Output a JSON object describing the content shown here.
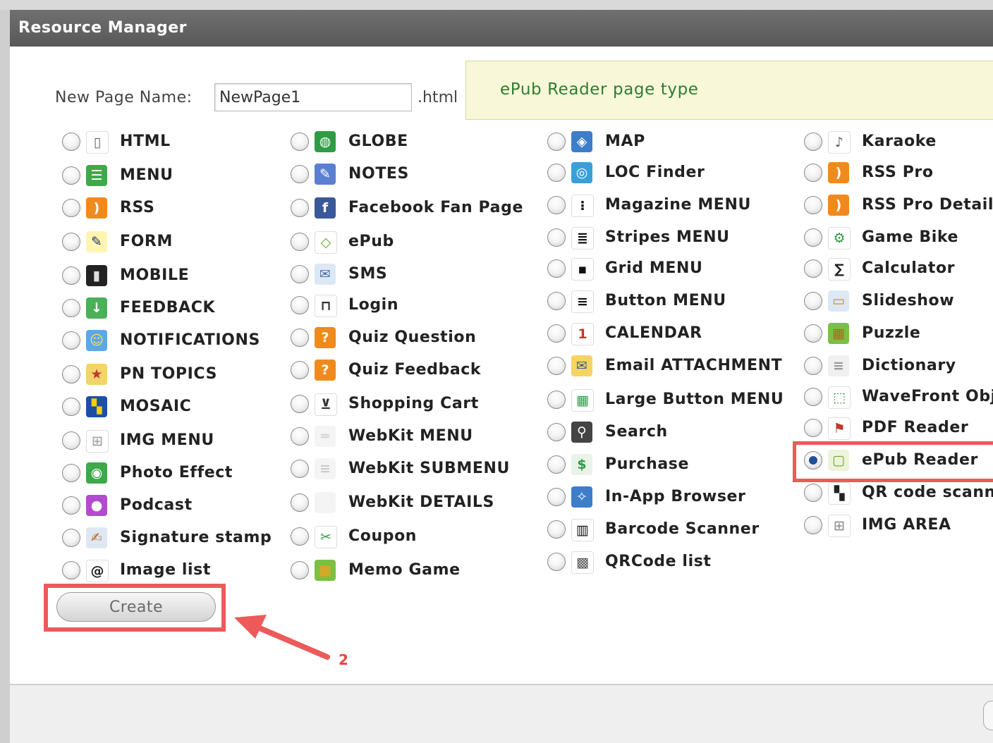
{
  "dialog": {
    "title": "Resource Manager",
    "page_name_label": "New Page Name:",
    "page_name_value": "NewPage1",
    "extension": ".html",
    "info_text": "ePub Reader page type",
    "create_label": "Create",
    "annotation_number": "2"
  },
  "columns": [
    [
      {
        "label": "HTML",
        "icon": "document-icon",
        "bg": "#ffffff",
        "fg": "#666666",
        "glyph": "▯"
      },
      {
        "label": "MENU",
        "icon": "menu-list-icon",
        "bg": "#3daa4a",
        "fg": "#ffffff",
        "glyph": "☰"
      },
      {
        "label": "RSS",
        "icon": "rss-icon",
        "bg": "#f08a1c",
        "fg": "#ffffff",
        "glyph": ")"
      },
      {
        "label": "FORM",
        "icon": "pencil-icon",
        "bg": "#fff5b0",
        "fg": "#223366",
        "glyph": "✎"
      },
      {
        "label": "MOBILE",
        "icon": "mobile-phone-icon",
        "bg": "#222222",
        "fg": "#dddddd",
        "glyph": "▮"
      },
      {
        "label": "FEEDBACK",
        "icon": "download-arrow-icon",
        "bg": "#49b157",
        "fg": "#ffffff",
        "glyph": "↓"
      },
      {
        "label": "NOTIFICATIONS",
        "icon": "smiley-icon",
        "bg": "#5aa8e8",
        "fg": "#ffe04a",
        "glyph": "☺"
      },
      {
        "label": "PN TOPICS",
        "icon": "star-tag-icon",
        "bg": "#f3d36b",
        "fg": "#c0392b",
        "glyph": "★"
      },
      {
        "label": "MOSAIC",
        "icon": "mosaic-icon",
        "bg": "#1b4fa8",
        "fg": "#ffcc00",
        "glyph": "▚"
      },
      {
        "label": "IMG MENU",
        "icon": "grid-icon",
        "bg": "#ffffff",
        "fg": "#aaaaaa",
        "glyph": "⊞"
      },
      {
        "label": "Photo Effect",
        "icon": "camera-icon",
        "bg": "#3daa4a",
        "fg": "#ffffff",
        "glyph": "◉"
      },
      {
        "label": "Podcast",
        "icon": "microphone-icon",
        "bg": "#b34bd1",
        "fg": "#ffffff",
        "glyph": "●"
      },
      {
        "label": "Signature stamp",
        "icon": "signature-icon",
        "bg": "#dfe7f3",
        "fg": "#b5651d",
        "glyph": "✍"
      },
      {
        "label": "Image list",
        "icon": "at-sign-icon",
        "bg": "#ffffff",
        "fg": "#222222",
        "glyph": "@"
      }
    ],
    [
      {
        "label": "GLOBE",
        "icon": "globe-icon",
        "bg": "#2e9c45",
        "fg": "#ffffff",
        "glyph": "◍"
      },
      {
        "label": "NOTES",
        "icon": "notes-icon",
        "bg": "#5b7fd1",
        "fg": "#ffffff",
        "glyph": "✎"
      },
      {
        "label": "Facebook Fan Page",
        "icon": "facebook-icon",
        "bg": "#3b5998",
        "fg": "#ffffff",
        "glyph": "f"
      },
      {
        "label": "ePub",
        "icon": "epub-icon",
        "bg": "#ffffff",
        "fg": "#6aa82d",
        "glyph": "◇"
      },
      {
        "label": "SMS",
        "icon": "envelope-icon",
        "bg": "#dde8f6",
        "fg": "#4a6fa5",
        "glyph": "✉"
      },
      {
        "label": "Login",
        "icon": "padlock-icon",
        "bg": "#ffffff",
        "fg": "#333333",
        "glyph": "⊓"
      },
      {
        "label": "Quiz Question",
        "icon": "question-mark-icon",
        "bg": "#f08a1c",
        "fg": "#ffffff",
        "glyph": "?"
      },
      {
        "label": "Quiz Feedback",
        "icon": "quiz-feedback-icon",
        "bg": "#f08a1c",
        "fg": "#ffffff",
        "glyph": "?"
      },
      {
        "label": "Shopping Cart",
        "icon": "shopping-cart-icon",
        "bg": "#ffffff",
        "fg": "#333333",
        "glyph": "⊻"
      },
      {
        "label": "WebKit MENU",
        "icon": "webkit-menu-icon",
        "bg": "#f4f4f4",
        "fg": "#cccccc",
        "glyph": "═"
      },
      {
        "label": "WebKit SUBMENU",
        "icon": "webkit-submenu-icon",
        "bg": "#f4f4f4",
        "fg": "#cccccc",
        "glyph": "≡"
      },
      {
        "label": "WebKit DETAILS",
        "icon": "webkit-details-icon",
        "bg": "#f4f4f4",
        "fg": "#cccccc",
        "glyph": " "
      },
      {
        "label": "Coupon",
        "icon": "scissors-icon",
        "bg": "#ffffff",
        "fg": "#2e9c45",
        "glyph": "✂"
      },
      {
        "label": "Memo Game",
        "icon": "memo-game-icon",
        "bg": "#7bc043",
        "fg": "#f6a21c",
        "glyph": "▦"
      }
    ],
    [
      {
        "label": "MAP",
        "icon": "map-icon",
        "bg": "#3d7dc9",
        "fg": "#ffffff",
        "glyph": "◈"
      },
      {
        "label": "LOC Finder",
        "icon": "location-finder-icon",
        "bg": "#3aa0d8",
        "fg": "#ffffff",
        "glyph": "◎"
      },
      {
        "label": "Magazine MENU",
        "icon": "list-bullets-icon",
        "bg": "#ffffff",
        "fg": "#111111",
        "glyph": "⁝"
      },
      {
        "label": "Stripes MENU",
        "icon": "stripes-icon",
        "bg": "#ffffff",
        "fg": "#111111",
        "glyph": "≣"
      },
      {
        "label": "Grid MENU",
        "icon": "grid-menu-icon",
        "bg": "#ffffff",
        "fg": "#111111",
        "glyph": "▪"
      },
      {
        "label": "Button MENU",
        "icon": "button-menu-icon",
        "bg": "#ffffff",
        "fg": "#111111",
        "glyph": "≡"
      },
      {
        "label": "CALENDAR",
        "icon": "calendar-icon",
        "bg": "#ffffff",
        "fg": "#c0392b",
        "glyph": "1"
      },
      {
        "label": "Email ATTACHMENT",
        "icon": "paperclip-icon",
        "bg": "#f6d365",
        "fg": "#3b5998",
        "glyph": "✉"
      },
      {
        "label": "Large Button MENU",
        "icon": "large-grid-icon",
        "bg": "#ffffff",
        "fg": "#2e9c45",
        "glyph": "▦"
      },
      {
        "label": "Search",
        "icon": "magnifier-icon",
        "bg": "#444444",
        "fg": "#ffffff",
        "glyph": "⚲"
      },
      {
        "label": "Purchase",
        "icon": "dollar-icon",
        "bg": "#e9f3e9",
        "fg": "#2e9c45",
        "glyph": "$"
      },
      {
        "label": "In-App Browser",
        "icon": "compass-icon",
        "bg": "#3d7dc9",
        "fg": "#ffffff",
        "glyph": "✧"
      },
      {
        "label": "Barcode Scanner",
        "icon": "barcode-icon",
        "bg": "#ffffff",
        "fg": "#111111",
        "glyph": "▥"
      },
      {
        "label": "QRCode list",
        "icon": "qrcode-icon",
        "bg": "#ffffff",
        "fg": "#555555",
        "glyph": "▩"
      }
    ],
    [
      {
        "label": "Karaoke",
        "icon": "microphone-icon",
        "bg": "#ffffff",
        "fg": "#666666",
        "glyph": "♪"
      },
      {
        "label": "RSS Pro",
        "icon": "rss-pro-icon",
        "bg": "#f08a1c",
        "fg": "#ffffff",
        "glyph": ")"
      },
      {
        "label": "RSS Pro Details",
        "icon": "rss-pro-details-icon",
        "bg": "#f08a1c",
        "fg": "#ffffff",
        "glyph": ")"
      },
      {
        "label": "Game Bike",
        "icon": "bike-icon",
        "bg": "#ffffff",
        "fg": "#2e9c45",
        "glyph": "⚙"
      },
      {
        "label": "Calculator",
        "icon": "sigma-icon",
        "bg": "#ffffff",
        "fg": "#222222",
        "glyph": "∑"
      },
      {
        "label": "Slideshow",
        "icon": "slideshow-icon",
        "bg": "#dde8f6",
        "fg": "#e67e22",
        "glyph": "▭"
      },
      {
        "label": "Puzzle",
        "icon": "puzzle-icon",
        "bg": "#7bc043",
        "fg": "#b5651d",
        "glyph": "▦"
      },
      {
        "label": "Dictionary",
        "icon": "dictionary-icon",
        "bg": "#f0f0f0",
        "fg": "#999999",
        "glyph": "≡"
      },
      {
        "label": "WaveFront Obj",
        "icon": "cube-icon",
        "bg": "#ffffff",
        "fg": "#2e9c45",
        "glyph": "⬚"
      },
      {
        "label": "PDF Reader",
        "icon": "pdf-icon",
        "bg": "#ffffff",
        "fg": "#c0392b",
        "glyph": "⚑"
      },
      {
        "label": "ePub Reader",
        "icon": "book-icon",
        "bg": "#eef3dc",
        "fg": "#6aa82d",
        "glyph": "▢",
        "checked": true
      },
      {
        "label": "QR code scann",
        "icon": "qr-scanner-icon",
        "bg": "#ffffff",
        "fg": "#222222",
        "glyph": "▚"
      },
      {
        "label": "IMG AREA",
        "icon": "img-area-icon",
        "bg": "#ffffff",
        "fg": "#999999",
        "glyph": "⊞"
      }
    ]
  ]
}
